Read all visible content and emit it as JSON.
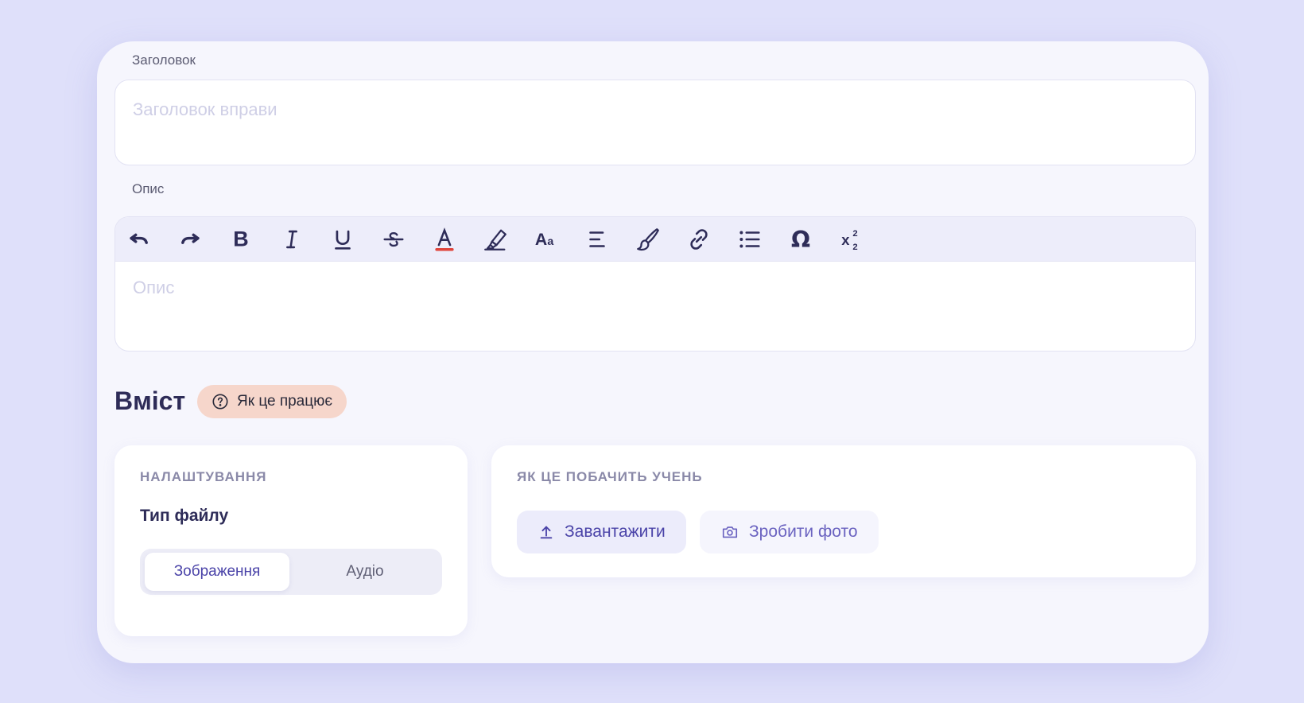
{
  "title_field": {
    "label": "Заголовок",
    "placeholder": "Заголовок вправи"
  },
  "description_field": {
    "label": "Опис",
    "placeholder": "Опис"
  },
  "toolbar": {
    "tools": [
      "undo-icon",
      "redo-icon",
      "bold-icon",
      "italic-icon",
      "underline-icon",
      "strikethrough-icon",
      "text-color-icon",
      "highlight-icon",
      "font-size-icon",
      "align-icon",
      "brush-icon",
      "link-icon",
      "bullet-list-icon",
      "omega-icon",
      "subscript-superscript-icon"
    ],
    "text_color_accent": "#e0443b"
  },
  "content_section": {
    "title": "Вміст",
    "help_pill": "Як це працює"
  },
  "settings_panel": {
    "caption": "НАЛАШТУВАННЯ",
    "file_type_title": "Тип файлу",
    "options": [
      "Зображення",
      "Аудіо"
    ],
    "selected": "Зображення"
  },
  "preview_panel": {
    "caption": "ЯК ЦЕ ПОБАЧИТЬ УЧЕНЬ",
    "upload_button": "Завантажити",
    "photo_button": "Зробити фото"
  },
  "colors": {
    "background": "#dfe0fa",
    "card": "#f6f6fd",
    "accent": "#4a43a8",
    "heading": "#2e2c58",
    "pill": "#f6d6cb"
  }
}
